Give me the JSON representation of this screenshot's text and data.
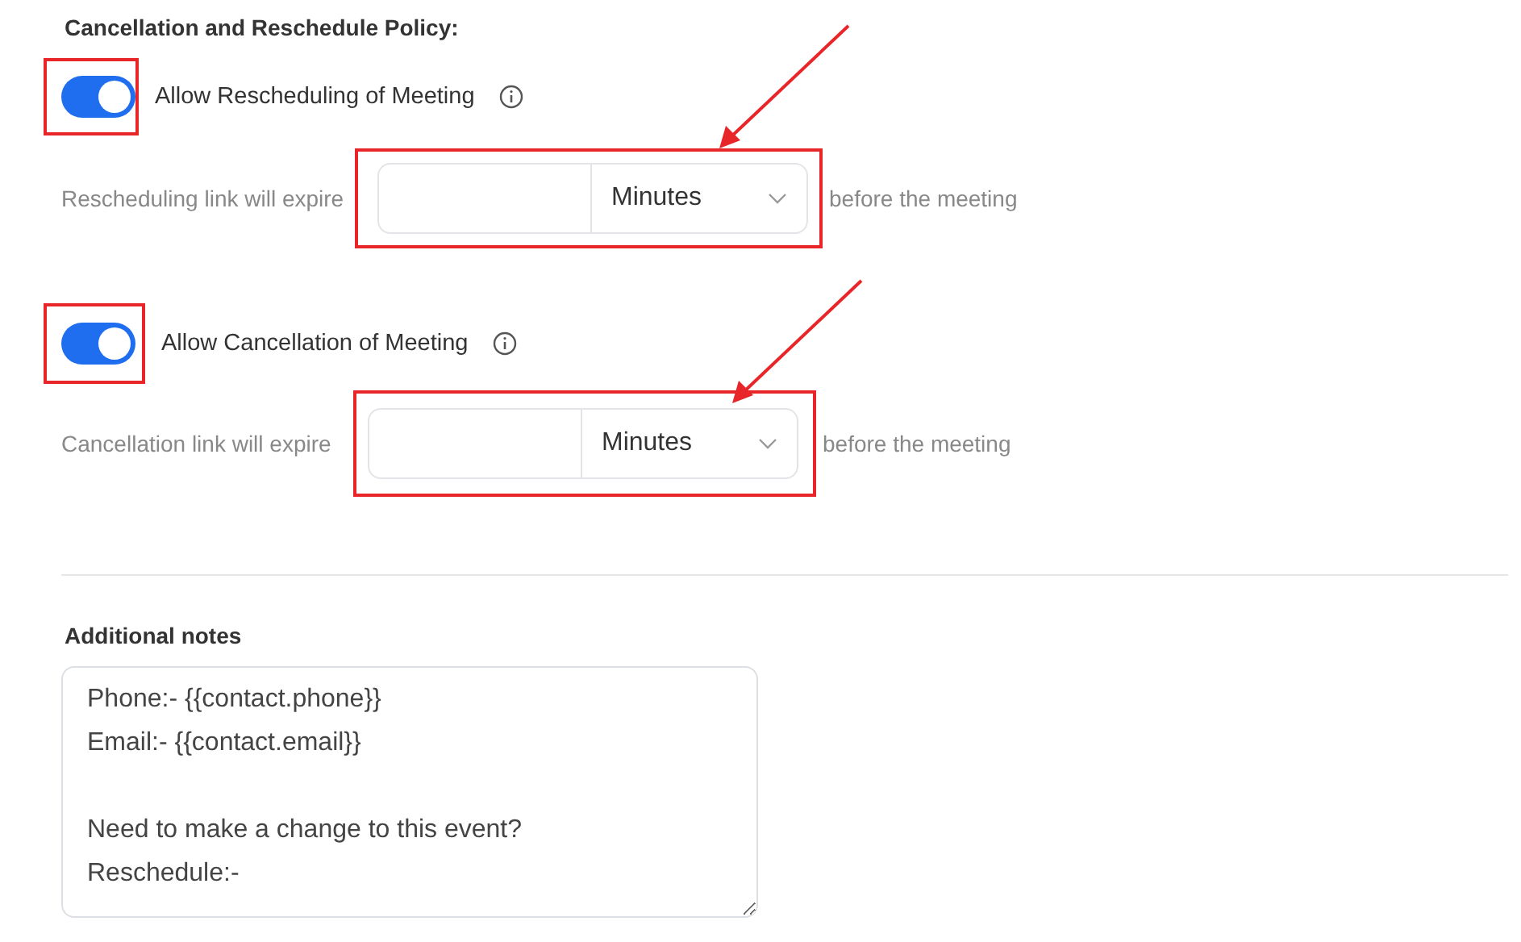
{
  "section_title": "Cancellation and Reschedule Policy:",
  "policies": [
    {
      "toggle_label": "Allow Rescheduling of Meeting",
      "on": true,
      "expire_label": "Rescheduling link will expire",
      "unit": "Minutes",
      "suffix": "before the meeting"
    },
    {
      "toggle_label": "Allow Cancellation of Meeting",
      "on": true,
      "expire_label": "Cancellation link will expire",
      "unit": "Minutes",
      "suffix": "before the meeting"
    }
  ],
  "additional_notes": {
    "label": "Additional notes",
    "value": "Phone:- {{contact.phone}}\nEmail:- {{contact.email}}\n\nNeed to make a change to this event?\nReschedule:-"
  }
}
